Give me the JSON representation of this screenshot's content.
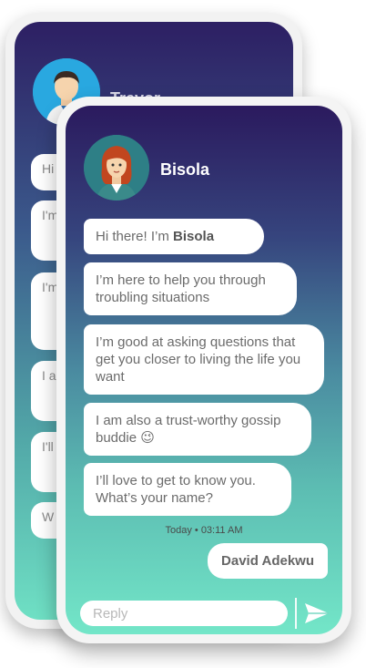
{
  "back_contact": {
    "name": "Trevor",
    "snippets": [
      "Hi",
      "I'm tro",
      "I'm th litt",
      "I a bu",
      "I'll m",
      "W"
    ]
  },
  "contact": {
    "name": "Bisola"
  },
  "messages": [
    {
      "pre": "Hi there! I’m ",
      "bold": "Bisola",
      "post": ""
    },
    {
      "text": "I’m here to help you through troubling situations"
    },
    {
      "text": "I’m good at asking questions that get you closer to living the life you want"
    },
    {
      "text": "I am also a trust-worthy gossip buddie",
      "emoji": "😉"
    },
    {
      "text": "I’ll love to get to know you. What’s your name?"
    }
  ],
  "timestamp": "Today • 03:11 AM",
  "outgoing": {
    "text": "David Adekwu"
  },
  "composer": {
    "placeholder": "Reply"
  },
  "colors": {
    "gradient_top": "#2b1a5e",
    "gradient_bottom": "#73e6c8",
    "emoji": "#f5c518"
  },
  "icons": {
    "send": "send-icon",
    "avatar": "avatar-icon"
  }
}
